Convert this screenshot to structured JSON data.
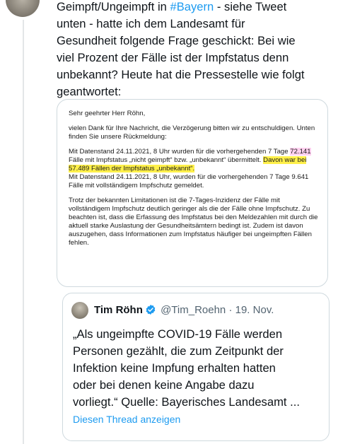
{
  "tweet": {
    "text_before_hashtag": "Geimpft/Ungeimpft in ",
    "hashtag": "#Bayern",
    "text_after_hashtag": " - siehe Tweet\nunten - hatte ich dem Landesamt für\nGesundheit folgende Frage geschickt: Bei wie\nviel Prozent der Fälle ist der Impfstatus denn\nunbekannt? Heute hat die Pressestelle wie folgt\ngeantwortet:"
  },
  "document": {
    "greeting": "Sehr geehrter Herr Röhn,",
    "intro": "vielen Dank für Ihre Nachricht, die Verzögerung bitten wir zu entschuldigen. Unten finden Sie unsere Rückmeldung:",
    "p1_a": "Mit Datenstand 24.11.2021, 8 Uhr wurden für die vorhergehenden 7 Tage ",
    "p1_hl_count": "72.141",
    "p1_b": " Fälle mit Impfstatus „nicht geimpft“ bzw. „unbekannt“ übermittelt. ",
    "p1_hl_unknown": "Davon war bei 57.489 Fällen der Impfstatus „unbekannt“.",
    "p1_c": "Mit Datenstand 24.11.2021, 8 Uhr, wurden für die vorhergehenden 7 Tage 9.641 Fälle mit vollständigem Impfschutz gemeldet.",
    "p2": "Trotz der bekannten Limitationen ist die 7-Tages-Inzidenz der Fälle mit vollständigem Impfschutz deutlich geringer als die der Fälle ohne Impfschutz. Zu beachten ist, dass die Erfassung des Impfstatus bei den Meldezahlen mit durch die aktuell starke Auslastung der Gesundheitsämtern bedingt ist. Zudem ist davon auszugehen, dass Informationen zum Impfstatus häufiger bei ungeimpften Fällen fehlen."
  },
  "quote": {
    "name": "Tim Röhn",
    "handle": "@Tim_Roehn",
    "separator": "·",
    "date": "19. Nov.",
    "body": "„Als ungeimpfte COVID-19 Fälle werden\nPersonen gezählt, die zum Zeitpunkt der\nInfektion keine Impfung erhalten hatten\noder bei denen keine Angabe dazu\nvorliegt.“ Quelle: Bayerisches Landesamt ...",
    "show_thread": "Diesen Thread anzeigen"
  },
  "colors": {
    "link": "#1d9bf0",
    "highlight_yellow": "#fff04a",
    "highlight_pink": "#ffd1f0",
    "verified": "#1d9bf0"
  },
  "icons": {
    "verified": "verified-badge-icon"
  }
}
